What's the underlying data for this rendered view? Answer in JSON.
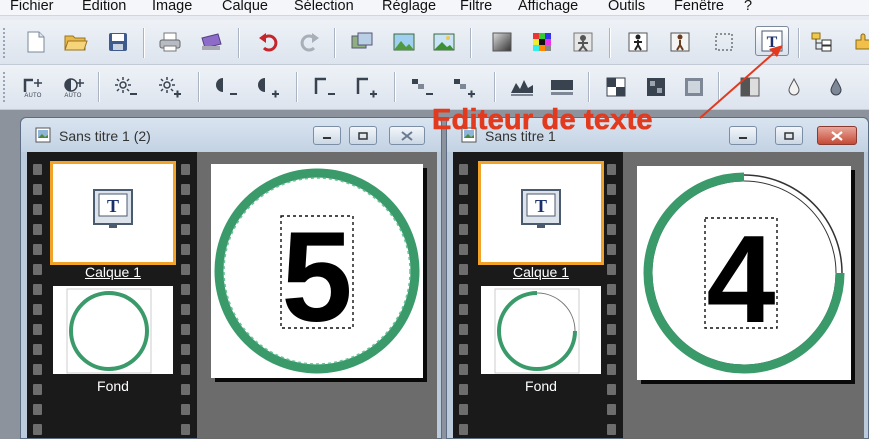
{
  "menubar": {
    "items": [
      "Fichier",
      "Edition",
      "Image",
      "Calque",
      "Sélection",
      "Réglage",
      "Filtre",
      "Affichage",
      "Outils",
      "Fenêtre",
      "?"
    ]
  },
  "toolbar1": {
    "icons": [
      "new-icon",
      "open-icon",
      "save-icon",
      "print-icon",
      "scan-icon",
      "undo-icon",
      "redo-icon",
      "image-size-icon",
      "landscape-icon",
      "picture-icon",
      "gradient-icon",
      "palette-icon",
      "effects-icon",
      "figure-icon",
      "person-icon",
      "selection-icon",
      "text-editor-icon",
      "layers-icon",
      "plugin-icon"
    ],
    "text_button_label": "T"
  },
  "toolbar2": {
    "auto_label": "AUTO",
    "icons": [
      "auto-contrast-icon",
      "auto-level-icon",
      "brightness-minus-icon",
      "brightness-plus-icon",
      "contrast-minus-icon",
      "contrast-plus-icon",
      "gamma-minus-icon",
      "gamma-plus-icon",
      "saturation-minus-icon",
      "saturation-plus-icon",
      "sharpen-icon",
      "blur-icon",
      "filter1-icon",
      "filter2-icon",
      "filter3-icon",
      "grayscale-icon",
      "drop-icon",
      "drop-fill-icon"
    ]
  },
  "annotation": {
    "text": "Editeur de texte",
    "color": "#e23a1e"
  },
  "window_left": {
    "title": "Sans titre 1 (2)",
    "layers": [
      {
        "name": "Calque 1",
        "selected": true,
        "type": "text"
      },
      {
        "name": "Fond",
        "selected": false,
        "type": "circle"
      }
    ],
    "canvas_digit": "5",
    "text_icon_label": "T"
  },
  "window_right": {
    "title": "Sans titre 1",
    "layers": [
      {
        "name": "Calque 1",
        "selected": true,
        "type": "text"
      },
      {
        "name": "Fond",
        "selected": false,
        "type": "circle-partial"
      }
    ],
    "canvas_digit": "4",
    "text_icon_label": "T"
  },
  "colors": {
    "ring_green": "#3a9a6a",
    "selection_orange": "#f1a229",
    "arrow_red": "#e23a1e"
  }
}
